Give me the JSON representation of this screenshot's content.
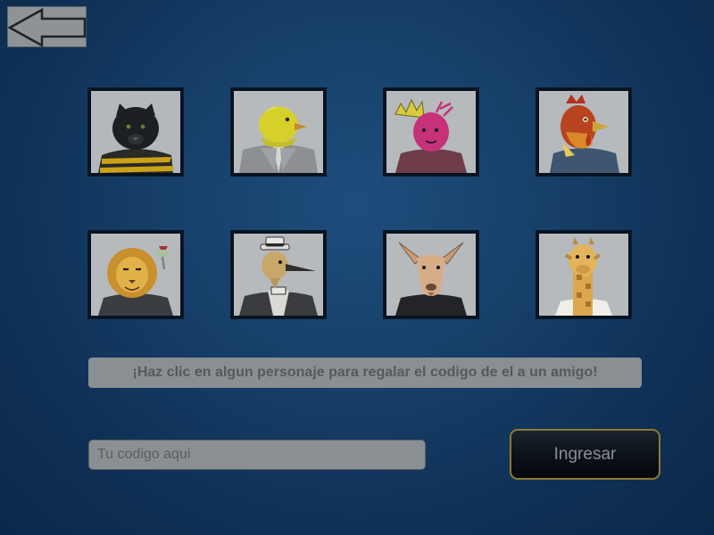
{
  "nav": {
    "back_icon": "arrow-left-icon"
  },
  "characters": [
    {
      "name": "black panther",
      "icon": "panther-character"
    },
    {
      "name": "yellow canary",
      "icon": "canary-character"
    },
    {
      "name": "pink creature with crown",
      "icon": "crowned-creature-character"
    },
    {
      "name": "rooster",
      "icon": "rooster-character"
    },
    {
      "name": "lion",
      "icon": "lion-character"
    },
    {
      "name": "bird with hat",
      "icon": "hatted-bird-character"
    },
    {
      "name": "kangaroo",
      "icon": "kangaroo-character"
    },
    {
      "name": "giraffe",
      "icon": "giraffe-character"
    }
  ],
  "hint_text": "¡Haz clic en algun personaje para regalar el codigo de el a un amigo!",
  "code_input": {
    "placeholder": "Tu codigo aqui",
    "value": ""
  },
  "submit_label": "Ingresar",
  "colors": {
    "accent_border": "#8a7a33",
    "background": "#163f69"
  }
}
